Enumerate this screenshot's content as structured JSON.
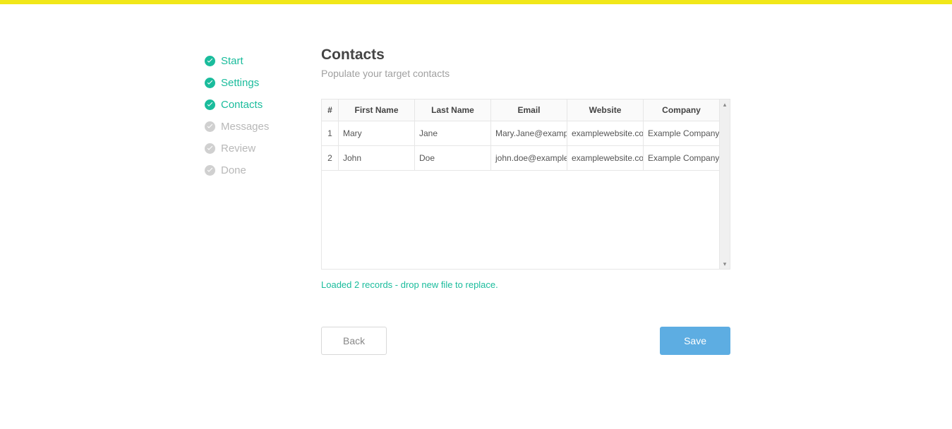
{
  "sidebar": {
    "steps": [
      {
        "label": "Start",
        "state": "done"
      },
      {
        "label": "Settings",
        "state": "done"
      },
      {
        "label": "Contacts",
        "state": "done"
      },
      {
        "label": "Messages",
        "state": "pending"
      },
      {
        "label": "Review",
        "state": "pending"
      },
      {
        "label": "Done",
        "state": "pending"
      }
    ]
  },
  "page": {
    "title": "Contacts",
    "subtitle": "Populate your target contacts"
  },
  "table": {
    "headers": {
      "num": "#",
      "first_name": "First Name",
      "last_name": "Last Name",
      "email": "Email",
      "website": "Website",
      "company": "Company"
    },
    "rows": [
      {
        "num": "1",
        "first_name": "Mary",
        "last_name": "Jane",
        "email": "Mary.Jane@examplemail.com",
        "website": "examplewebsite.com",
        "company": "Example Company"
      },
      {
        "num": "2",
        "first_name": "John",
        "last_name": "Doe",
        "email": "john.doe@examplemail.com",
        "website": "examplewebsite.com",
        "company": "Example Company"
      }
    ]
  },
  "status": "Loaded 2 records - drop new file to replace.",
  "buttons": {
    "back": "Back",
    "save": "Save"
  }
}
